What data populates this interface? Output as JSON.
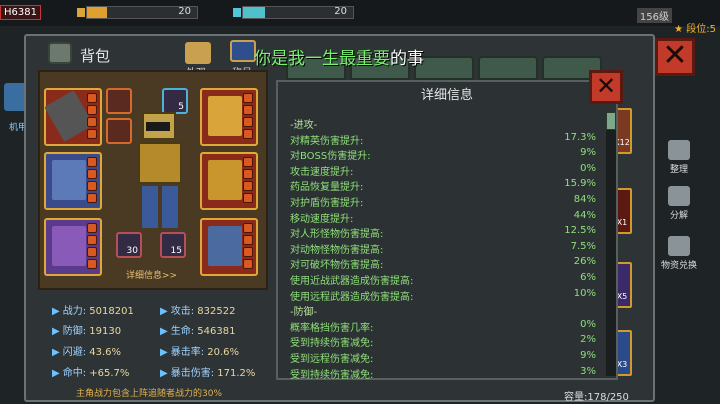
{
  "hud": {
    "player_tag": "H6381",
    "res1_value": "20",
    "res1_fill": 0.18,
    "res2_value": "20",
    "res2_fill": 0.2,
    "level_text": "156级",
    "rank_text": "★ 段位:5"
  },
  "dialog": {
    "banner_green": "你是我一生最重要",
    "banner_white": "的事",
    "bag_title": "背包",
    "tab_appearance": "外观",
    "tab_title": "称号",
    "side_mech": "机甲"
  },
  "equipment": {
    "badge_a": "5",
    "badge_b": "30",
    "badge_c": "15",
    "detail_link": "详细信息>>"
  },
  "stats": {
    "power_label": "战力:",
    "power_value": "5018201",
    "attack_label": "攻击:",
    "attack_value": "832522",
    "defense_label": "防御:",
    "defense_value": "19130",
    "hp_label": "生命:",
    "hp_value": "546381",
    "dodge_label": "闪避:",
    "dodge_value": "43.6%",
    "crit_label": "暴击率:",
    "crit_value": "20.6%",
    "hit_label": "命中:",
    "hit_value": "+65.7%",
    "critdmg_label": "暴击伤害:",
    "critdmg_value": "171.2%",
    "note": "主角战力包含上阵追随者战力的30%"
  },
  "detail": {
    "title": "详细信息",
    "rows": [
      {
        "k": "-进攻-",
        "v": ""
      },
      {
        "k": "对精英伤害提升:",
        "v": "17.3%"
      },
      {
        "k": "对BOSS伤害提升:",
        "v": "9%"
      },
      {
        "k": "攻击速度提升:",
        "v": "0%"
      },
      {
        "k": "药品恢复量提升:",
        "v": "15.9%"
      },
      {
        "k": "对护盾伤害提升:",
        "v": "84%"
      },
      {
        "k": "移动速度提升:",
        "v": "44%"
      },
      {
        "k": "对人形怪物伤害提高:",
        "v": "12.5%"
      },
      {
        "k": "对动物怪物伤害提高:",
        "v": "7.5%"
      },
      {
        "k": "对可破坏物伤害提高:",
        "v": "26%"
      },
      {
        "k": "使用近战武器造成伤害提高:",
        "v": "6%"
      },
      {
        "k": "使用远程武器造成伤害提高:",
        "v": "10%"
      },
      {
        "k": "-防御-",
        "v": ""
      },
      {
        "k": "概率格挡伤害几率:",
        "v": "0%"
      },
      {
        "k": "受到持续伤害减免:",
        "v": "2%"
      },
      {
        "k": "受到远程伤害减免:",
        "v": "9%"
      },
      {
        "k": "受到持续伤害减免:",
        "v": "3%"
      }
    ]
  },
  "inventory": {
    "capacity": "容量:178/250",
    "peek_a": "X12",
    "peek_b": "X1",
    "peek_c": "X5",
    "peek_d": "X3"
  },
  "sidebar": {
    "sort": "整理",
    "decompose": "分解",
    "exchange": "物资兑换"
  },
  "colors": {
    "accent_green": "#7cf070",
    "close_red": "#c23a2a",
    "slot_gold": "#e0a838"
  }
}
